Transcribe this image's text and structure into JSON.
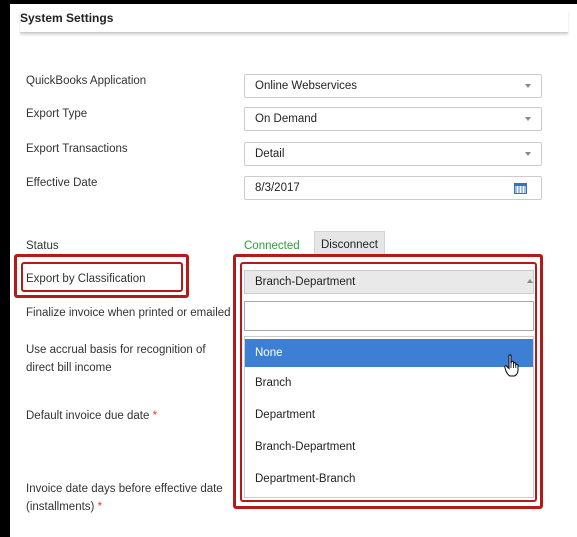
{
  "panel": {
    "title": "System Settings"
  },
  "fields": {
    "qb_app": {
      "label": "QuickBooks Application",
      "value": "Online Webservices"
    },
    "export_type": {
      "label": "Export Type",
      "value": "On Demand"
    },
    "export_transactions": {
      "label": "Export Transactions",
      "value": "Detail"
    },
    "effective_date": {
      "label": "Effective Date",
      "value": "8/3/2017"
    },
    "status": {
      "label": "Status",
      "value": "Connected",
      "button": "Disconnect"
    },
    "export_by_classification": {
      "label": "Export by Classification",
      "value": "Branch-Department"
    },
    "finalize_invoice": {
      "label": "Finalize invoice when printed or emailed"
    },
    "accrual_basis": {
      "label_line1": "Use accrual basis for recognition of",
      "label_line2": "direct bill income"
    },
    "default_due_date": {
      "label": "Default invoice due date",
      "required_mark": "*"
    },
    "invoice_date_days": {
      "label_line1": "Invoice date days before effective date",
      "label_line2": "(installments)",
      "required_mark": "*"
    }
  },
  "dropdown": {
    "search_value": "",
    "options": [
      "None",
      "Branch",
      "Department",
      "Branch-Department",
      "Department-Branch"
    ],
    "highlighted": "None"
  },
  "colors": {
    "highlight_border": "#b31b1b",
    "active_option": "#3e7fd6",
    "connected": "#2e9c3c",
    "required": "#e53935"
  },
  "icons": {
    "calendar": "calendar-icon",
    "cursor": "hand-pointer-icon",
    "caret": "caret-down-icon"
  }
}
